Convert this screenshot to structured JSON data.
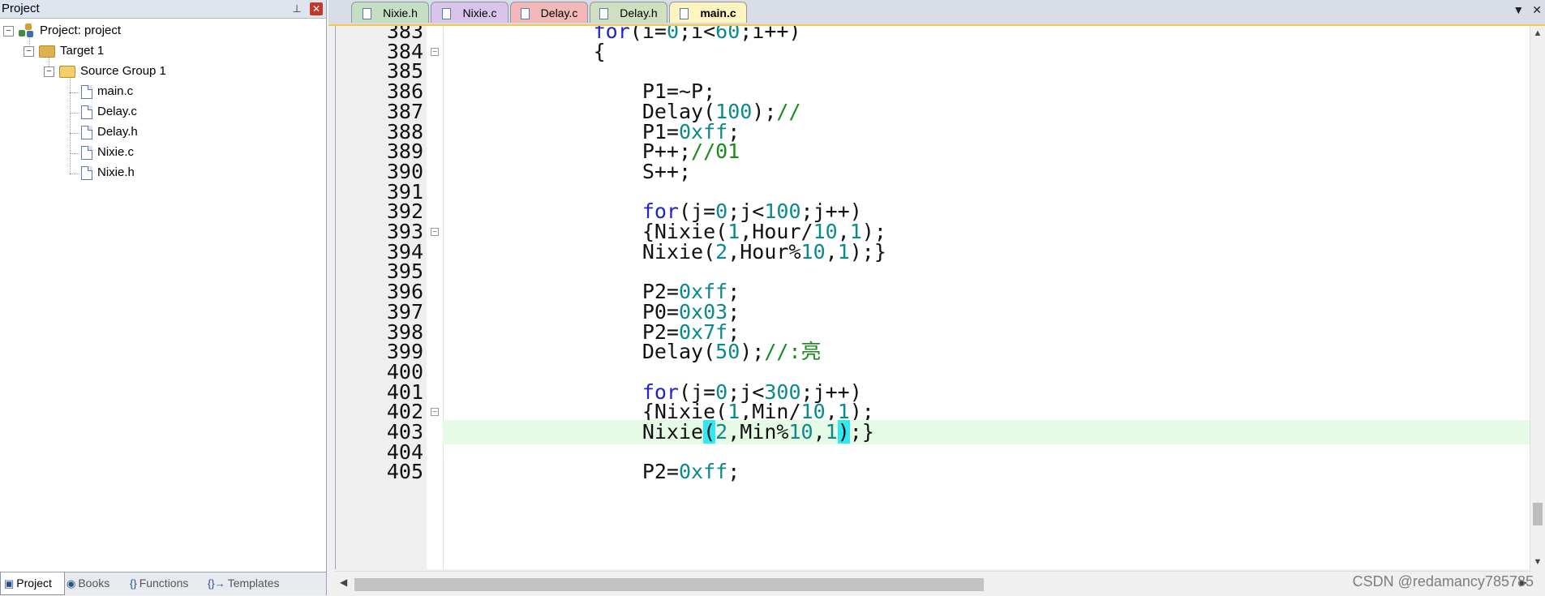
{
  "project_panel": {
    "title": "Project",
    "tree": {
      "project": "Project: project",
      "target": "Target 1",
      "group": "Source Group 1",
      "files": [
        "main.c",
        "Delay.c",
        "Delay.h",
        "Nixie.c",
        "Nixie.h"
      ]
    },
    "bottom_tabs": [
      {
        "label": "Project",
        "icon": "project-icon"
      },
      {
        "label": "Books",
        "icon": "books-icon"
      },
      {
        "label": "Functions",
        "icon": "functions-icon"
      },
      {
        "label": "Templates",
        "icon": "templates-icon"
      }
    ]
  },
  "editor": {
    "tabs": [
      {
        "label": "Nixie.h",
        "color": "#c5dfc5"
      },
      {
        "label": "Nixie.c",
        "color": "#d9c5ea"
      },
      {
        "label": "Delay.c",
        "color": "#f2b8b8"
      },
      {
        "label": "Delay.h",
        "color": "#cfe0c0"
      },
      {
        "label": "main.c",
        "color": "#fff4bf",
        "active": true
      }
    ],
    "lines": [
      {
        "n": "383",
        "code": "            for(i=0;i<60;i++)"
      },
      {
        "n": "384",
        "code": "            {"
      },
      {
        "n": "385",
        "code": ""
      },
      {
        "n": "386",
        "code": "                P1=~P;"
      },
      {
        "n": "387",
        "code": "                Delay(100);//"
      },
      {
        "n": "388",
        "code": "                P1=0xff;"
      },
      {
        "n": "389",
        "code": "                P++;//01"
      },
      {
        "n": "390",
        "code": "                S++;"
      },
      {
        "n": "391",
        "code": ""
      },
      {
        "n": "392",
        "code": "                for(j=0;j<100;j++)"
      },
      {
        "n": "393",
        "code": "                {Nixie(1,Hour/10,1);"
      },
      {
        "n": "394",
        "code": "                Nixie(2,Hour%10,1);}"
      },
      {
        "n": "395",
        "code": ""
      },
      {
        "n": "396",
        "code": "                P2=0xff;"
      },
      {
        "n": "397",
        "code": "                P0=0x03;"
      },
      {
        "n": "398",
        "code": "                P2=0x7f;"
      },
      {
        "n": "399",
        "code": "                Delay(50);//:亮"
      },
      {
        "n": "400",
        "code": ""
      },
      {
        "n": "401",
        "code": "                for(j=0;j<300;j++)"
      },
      {
        "n": "402",
        "code": "                {Nixie(1,Min/10,1);"
      },
      {
        "n": "403",
        "code": "                Nixie(2,Min%10,1);}"
      },
      {
        "n": "404",
        "code": ""
      },
      {
        "n": "405",
        "code": "                P2=0xff;"
      }
    ],
    "current_line": "403",
    "tab_menu_glyph": "▼",
    "tab_close_glyph": "✕"
  },
  "watermark": "CSDN @redamancy785785"
}
